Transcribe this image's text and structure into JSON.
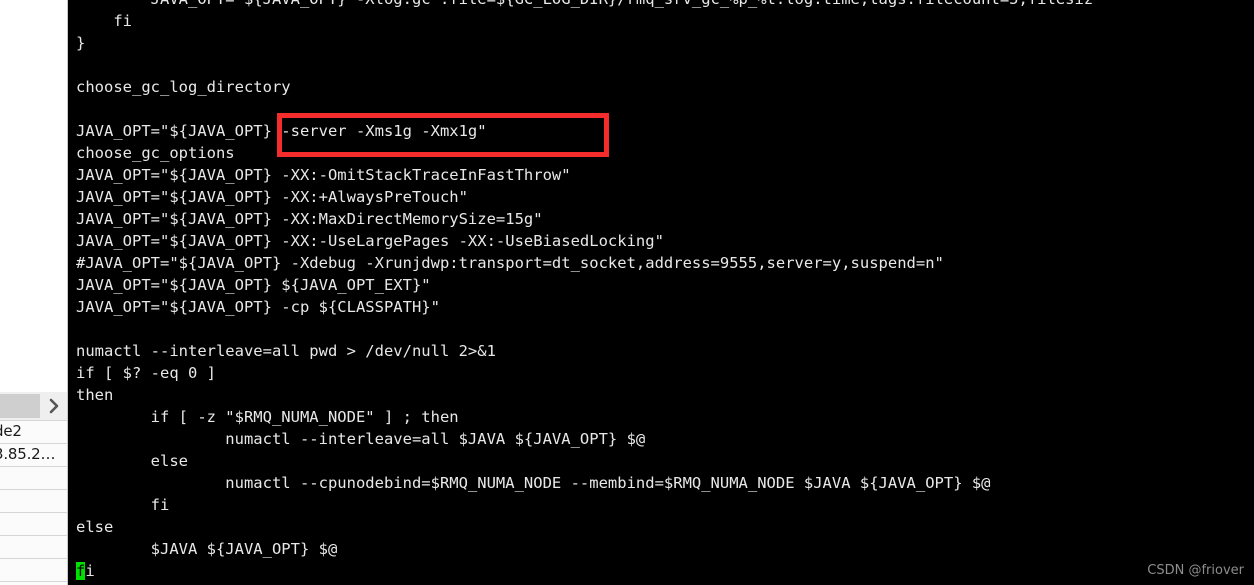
{
  "window": {
    "background_color": "#000000",
    "foreground_color": "#e8e8e8"
  },
  "left_panel": {
    "tabstrip": {
      "chevron_label": "›"
    },
    "table_rows": [
      {
        "text": "de2"
      },
      {
        "text": "3.85.2…"
      },
      {
        "text": ""
      },
      {
        "text": ""
      },
      {
        "text": ""
      },
      {
        "text": ""
      },
      {
        "text": ""
      }
    ]
  },
  "terminal": {
    "lines": [
      "        JAVA_OPT=\"${JAVA_OPT} -Xlog:gc*:file=${GC_LOG_DIR}/rmq_srv_gc_%p_%t.log:time,tags:filecount=5,filesiz",
      "    fi",
      "}",
      "",
      "choose_gc_log_directory",
      "",
      "JAVA_OPT=\"${JAVA_OPT} -server -Xms1g -Xmx1g\"",
      "choose_gc_options",
      "JAVA_OPT=\"${JAVA_OPT} -XX:-OmitStackTraceInFastThrow\"",
      "JAVA_OPT=\"${JAVA_OPT} -XX:+AlwaysPreTouch\"",
      "JAVA_OPT=\"${JAVA_OPT} -XX:MaxDirectMemorySize=15g\"",
      "JAVA_OPT=\"${JAVA_OPT} -XX:-UseLargePages -XX:-UseBiasedLocking\"",
      "#JAVA_OPT=\"${JAVA_OPT} -Xdebug -Xrunjdwp:transport=dt_socket,address=9555,server=y,suspend=n\"",
      "JAVA_OPT=\"${JAVA_OPT} ${JAVA_OPT_EXT}\"",
      "JAVA_OPT=\"${JAVA_OPT} -cp ${CLASSPATH}\"",
      "",
      "numactl --interleave=all pwd > /dev/null 2>&1",
      "if [ $? -eq 0 ]",
      "then",
      "        if [ -z \"$RMQ_NUMA_NODE\" ] ; then",
      "                numactl --interleave=all $JAVA ${JAVA_OPT} $@",
      "        else",
      "                numactl --cpunodebind=$RMQ_NUMA_NODE --membind=$RMQ_NUMA_NODE $JAVA ${JAVA_OPT} $@",
      "        fi",
      "else",
      "        $JAVA ${JAVA_OPT} $@"
    ],
    "last_line": {
      "cursor_char": "f",
      "rest": "i"
    }
  },
  "annotation": {
    "highlight_color": "#f52c2c",
    "highlighted_text": "T} -server -Xms1g -Xmx1g\""
  },
  "watermark": {
    "text": "CSDN @friover"
  }
}
